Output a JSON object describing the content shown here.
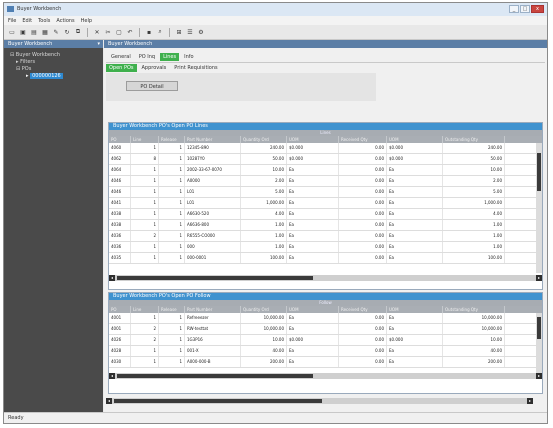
{
  "window": {
    "title": "Buyer Workbench",
    "buttons": {
      "minimize": "_",
      "maximize": "□",
      "close": "x"
    }
  },
  "menu": [
    "File",
    "Edit",
    "Tools",
    "Actions",
    "Help"
  ],
  "toolbar_icons": [
    "new-icon",
    "save-icon",
    "save-all-icon",
    "print-icon",
    "edit-icon",
    "refresh-icon",
    "copy-icon",
    "delete-icon",
    "cut-icon",
    "paste-icon",
    "undo-icon",
    "lock-icon",
    "search-icon",
    "grid-icon",
    "list-icon",
    "settings-icon"
  ],
  "sidebar": {
    "header": "Buyer Workbench",
    "pin": "▾",
    "tree": [
      {
        "label": "Buyer Workbench",
        "indent": 1,
        "selected": false
      },
      {
        "label": "Filters",
        "indent": 2,
        "selected": false
      },
      {
        "label": "POs",
        "indent": 2,
        "selected": false
      },
      {
        "label": "000000126",
        "indent": 3,
        "selected": true
      }
    ]
  },
  "main": {
    "header": "Buyer Workbench",
    "tabs1": [
      {
        "label": "General",
        "active": false
      },
      {
        "label": "PO Inq",
        "active": false
      },
      {
        "label": "Lines",
        "active": true
      },
      {
        "label": "Info",
        "active": false
      }
    ],
    "tabs2": [
      {
        "label": "Open POs",
        "active": true
      },
      {
        "label": "Approvals",
        "active": false
      },
      {
        "label": "Print Requisitions",
        "active": false
      }
    ],
    "filter_button": "PO Detail"
  },
  "grid1": {
    "title": "Buyer Workbench PO's Open PO Lines",
    "band": "Lines",
    "columns": [
      "PO",
      "Line",
      "Release",
      "Part Number",
      "Quantity Ord",
      "UOM",
      "Received Qty",
      "UOM",
      "Outstanding Qty"
    ],
    "rows": [
      [
        "4060",
        "1",
        "1",
        "12345-890",
        "240.00",
        "$0.000",
        "0.00",
        "$0.000",
        "240.00"
      ],
      [
        "4062",
        "8",
        "1",
        "10287Y0",
        "50.00",
        "$0.000",
        "0.00",
        "$0.000",
        "50.00"
      ],
      [
        "4064",
        "1",
        "1",
        "2002-33-67-0070",
        "10.00",
        "Ea",
        "0.00",
        "Ea",
        "10.00"
      ],
      [
        "4046",
        "1",
        "1",
        "A0000",
        "2.00",
        "Ea",
        "0.00",
        "Ea",
        "2.00"
      ],
      [
        "4046",
        "1",
        "1",
        "L01",
        "5.00",
        "Ea",
        "0.00",
        "Ea",
        "5.00"
      ],
      [
        "4041",
        "1",
        "1",
        "L01",
        "1,000.00",
        "Ea",
        "0.00",
        "Ea",
        "1,000.00"
      ],
      [
        "4038",
        "1",
        "1",
        "A6630-520",
        "4.00",
        "Ea",
        "0.00",
        "Ea",
        "4.00"
      ],
      [
        "4038",
        "1",
        "1",
        "A6636-800",
        "1.00",
        "Ea",
        "0.00",
        "Ea",
        "1.00"
      ],
      [
        "4036",
        "2",
        "1",
        "R6555-CO000",
        "1.00",
        "Ea",
        "0.00",
        "Ea",
        "1.00"
      ],
      [
        "4036",
        "1",
        "1",
        "000",
        "1.00",
        "Ea",
        "0.00",
        "Ea",
        "1.00"
      ],
      [
        "4035",
        "1",
        "1",
        "000-0001",
        "100.00",
        "Ea",
        "0.00",
        "Ea",
        "100.00"
      ]
    ]
  },
  "grid2": {
    "title": "Buyer Workbench PO's Open PO Follow",
    "band": "Follow",
    "columns": [
      "PO",
      "Line",
      "Release",
      "Part Number",
      "Quantity Ord",
      "UOM",
      "Received Qty",
      "UOM",
      "Outstanding Qty"
    ],
    "rows": [
      [
        "4001",
        "1",
        "1",
        "Refreeezer",
        "10,000.00",
        "Ea",
        "0.00",
        "Ea",
        "10,000.00"
      ],
      [
        "4001",
        "2",
        "1",
        "RW-testtat",
        "10,000.00",
        "Ea",
        "0.00",
        "Ea",
        "10,000.00"
      ],
      [
        "4026",
        "2",
        "1",
        "1G3P16",
        "10.00",
        "$0.000",
        "0.00",
        "$0.000",
        "10.00"
      ],
      [
        "4028",
        "1",
        "1",
        "001-X",
        "40.00",
        "Ea",
        "0.00",
        "Ea",
        "40.00"
      ],
      [
        "4030",
        "1",
        "1",
        "A000-000-B",
        "200.00",
        "Ea",
        "0.00",
        "Ea",
        "200.00"
      ]
    ]
  },
  "status": {
    "text": "Ready"
  }
}
